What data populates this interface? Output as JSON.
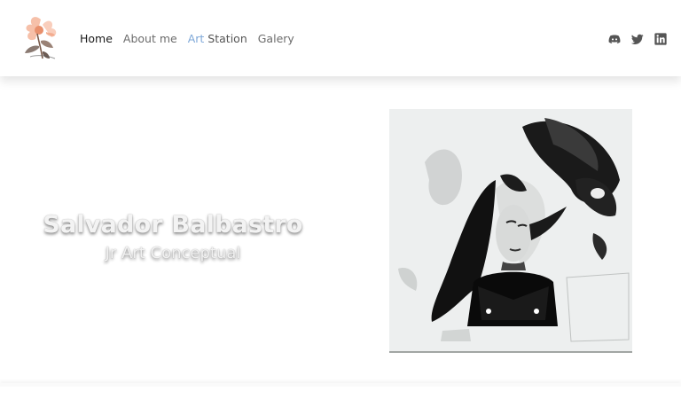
{
  "nav": {
    "logo_icon": "flower-logo-icon",
    "links": [
      {
        "label": "Home"
      },
      {
        "label": "About me"
      },
      {
        "label_accent": "Art",
        "label_rest": " Station"
      },
      {
        "label": "Galery"
      }
    ],
    "social_icons": [
      "discord-icon",
      "twitter-icon",
      "linkedin-icon"
    ]
  },
  "hero": {
    "name": "Salvador Balbastro",
    "subtitle": "Jr Art Conceptual"
  },
  "artwork": {
    "icon": "ink-portrait-artwork"
  },
  "colors": {
    "accent": "#7fa8d8",
    "nav_text": "#6c6c6c",
    "active_text": "#1a1a1a"
  }
}
